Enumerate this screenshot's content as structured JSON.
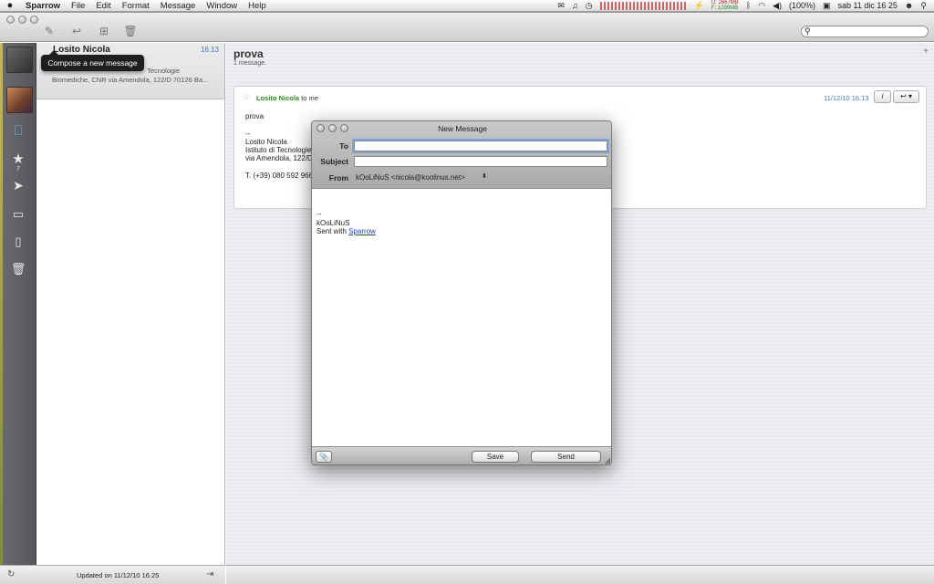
{
  "menubar": {
    "apple": "",
    "items": [
      "Sparrow",
      "File",
      "Edit",
      "Format",
      "Message",
      "Window",
      "Help"
    ],
    "mem_used": "U: 2667MB",
    "mem_free": "F: 1299MB",
    "battery": "(100%)",
    "clock": "sab 11 dic  16 25"
  },
  "toolbar": {
    "compose_icon": "pencil-compose-icon",
    "reply_icon": "reply-arrow-icon",
    "archive_icon": "archive-box-icon",
    "trash_icon": "trash-icon",
    "search_placeholder": ""
  },
  "sidebar": {
    "starred_count": "7"
  },
  "tooltip": "Compose a new message",
  "list": {
    "sender": "Losito Nicola",
    "time": "16.13",
    "preview_line1": "Tecnologie",
    "preview_line2": "Biomediche, CNR via Amendola, 122/D 70126 Ba...",
    "updated": "Updated on 11/12/10 16.25"
  },
  "message": {
    "subject": "prova",
    "count": "1 message.",
    "from": "Losito Nicola",
    "to": "to me",
    "date": "11/12/10 16.13",
    "body": [
      "prova",
      "",
      "--",
      "Losito Nicola",
      "Istituto di Tecnologie",
      "via Amendola, 122/D",
      "",
      "T. (+39) 080 592 966"
    ]
  },
  "compose": {
    "title": "New Message",
    "to_label": "To",
    "subject_label": "Subject",
    "from_label": "From",
    "to_value": "",
    "subject_value": "",
    "from_value": "kOoLiNuS <nicola@koolinus.net>",
    "signature_dash": "--",
    "signature_name": "kOoLiNuS",
    "sent_with": "Sent with ",
    "sparrow_link": "Sparrow",
    "save": "Save",
    "send": "Send"
  }
}
